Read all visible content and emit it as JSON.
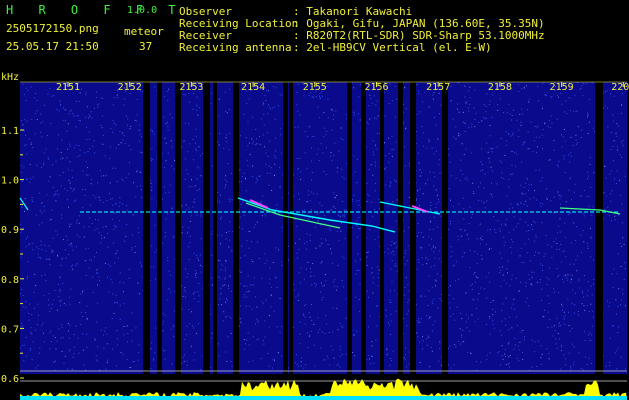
{
  "header": {
    "app_name": "H R O F F T",
    "version": "1.0.0",
    "filename": "2505172150.png",
    "datetime": "25.05.17 21:50",
    "mode_label": "meteor",
    "count": "37",
    "info_labels": [
      "Observer",
      "Receiving Location",
      "Receiver",
      "Receiving antenna"
    ],
    "info_values": [
      ": Takanori Kawachi",
      ": Ogaki, Gifu, JAPAN (136.60E, 35.35N)",
      ": R820T2(RTL-SDR) SDR-Sharp 53.1000MHz",
      ": 2el-HB9CV Vertical (el. E-W)"
    ]
  },
  "spectrogram": {
    "unit_label": "kHz",
    "time_labels": [
      "2151",
      "2152",
      "2153",
      "2154",
      "2155",
      "2156",
      "2157",
      "2158",
      "2159",
      "2200"
    ],
    "freq_labels": [
      "1.1",
      "1.0",
      "0.9",
      "0.8",
      "0.7",
      "0.6"
    ],
    "colors": {
      "background": "#0a0a8c",
      "noise": "#3a5aff",
      "signal": "#00ffff",
      "hot": "#ff40ff",
      "gap": "#000000",
      "axis": "#f0f03c",
      "meter": "#ffff00",
      "meter_base": "#00e0ff"
    }
  }
}
